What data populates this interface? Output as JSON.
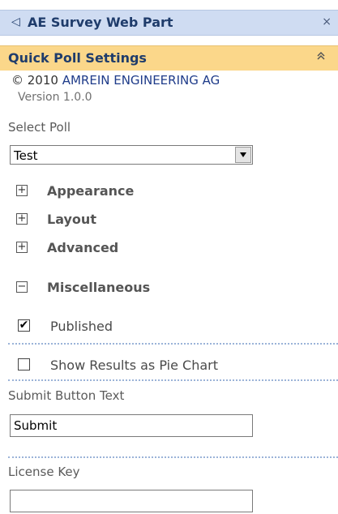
{
  "header": {
    "back_glyph": "◁",
    "title": "AE Survey Web Part",
    "close_glyph": "×"
  },
  "section": {
    "label": "Quick Poll Settings",
    "collapse_glyph": "≈"
  },
  "copyright": {
    "prefix": "© 2010 ",
    "company": "AMREIN ENGINEERING AG"
  },
  "version": "Version 1.0.0",
  "select_poll": {
    "label": "Select Poll",
    "value": "Test"
  },
  "groups": [
    {
      "label": "Appearance",
      "toggle": "+"
    },
    {
      "label": "Layout",
      "toggle": "+"
    },
    {
      "label": "Advanced",
      "toggle": "+"
    },
    {
      "label": "Miscellaneous",
      "toggle": "−"
    }
  ],
  "checkboxes": [
    {
      "label": "Published",
      "checked": true,
      "mark": "✔"
    },
    {
      "label": "Show Results as Pie Chart",
      "checked": false,
      "mark": ""
    }
  ],
  "submit_text": {
    "label": "Submit Button Text",
    "value": "Submit"
  },
  "license": {
    "label": "License Key",
    "value": ""
  }
}
